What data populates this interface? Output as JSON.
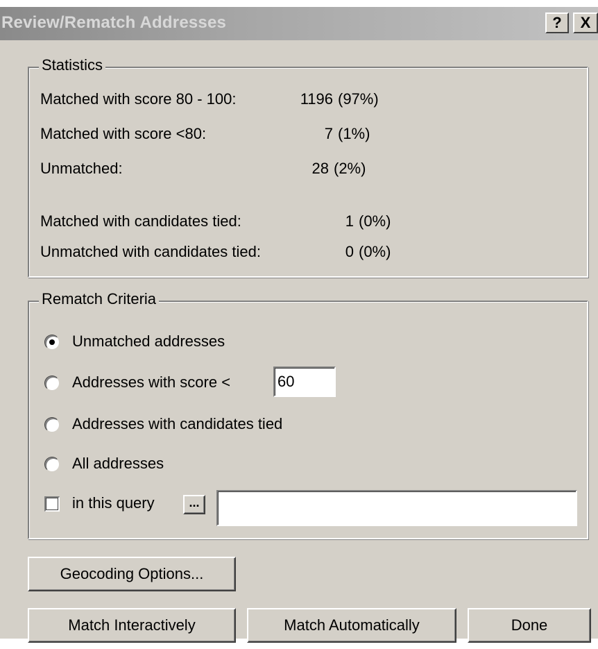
{
  "window": {
    "title": "Review/Rematch Addresses",
    "help_label": "?",
    "close_label": "X"
  },
  "statistics": {
    "legend": "Statistics",
    "rows": [
      {
        "label": "Matched with score 80 - 100:",
        "count": "1196",
        "percent": "(97%)"
      },
      {
        "label": "Matched with score <80:",
        "count": "7",
        "percent": "(1%)"
      },
      {
        "label": "Unmatched:",
        "count": "28",
        "percent": "(2%)"
      },
      {
        "label": "Matched with candidates tied:",
        "count": "1",
        "percent": "(0%)"
      },
      {
        "label": "Unmatched with candidates tied:",
        "count": "0",
        "percent": "(0%)"
      }
    ]
  },
  "rematch": {
    "legend": "Rematch Criteria",
    "options": [
      {
        "label": "Unmatched addresses",
        "selected": true
      },
      {
        "label": "Addresses with score <",
        "selected": false
      },
      {
        "label": "Addresses with candidates tied",
        "selected": false
      },
      {
        "label": "All addresses",
        "selected": false
      }
    ],
    "score_value": "60",
    "query_label": "in this query",
    "query_checked": false,
    "query_browse_label": "...",
    "query_value": ""
  },
  "buttons": {
    "geocoding_options": "Geocoding Options...",
    "match_interactively": "Match Interactively",
    "match_automatically": "Match Automatically",
    "done": "Done"
  }
}
